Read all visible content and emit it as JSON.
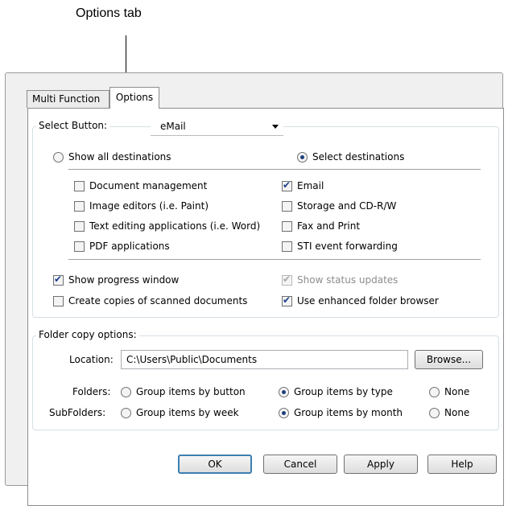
{
  "callout": {
    "label": "Options tab"
  },
  "tabs": [
    {
      "label": "Multi Function"
    },
    {
      "label": "Options"
    }
  ],
  "select_button": {
    "label": "Select Button:",
    "value": "eMail"
  },
  "destinations": {
    "show_all_label": "Show all destinations",
    "show_all_selected": false,
    "select_label": "Select destinations",
    "select_selected": true,
    "left_items": [
      {
        "label": "Document management",
        "checked": false
      },
      {
        "label": "Image editors (i.e. Paint)",
        "checked": false
      },
      {
        "label": "Text editing applications (i.e. Word)",
        "checked": false
      },
      {
        "label": "PDF applications",
        "checked": false
      }
    ],
    "right_items": [
      {
        "label": "Email",
        "checked": true
      },
      {
        "label": "Storage and CD-R/W",
        "checked": false
      },
      {
        "label": "Fax and Print",
        "checked": false
      },
      {
        "label": "STI event forwarding",
        "checked": false
      }
    ]
  },
  "options": {
    "show_progress": {
      "label": "Show progress window",
      "checked": true
    },
    "show_status": {
      "label": "Show status updates",
      "checked": true,
      "disabled": true
    },
    "create_copies": {
      "label": "Create copies of scanned documents",
      "checked": false
    },
    "enhanced_browser": {
      "label": "Use enhanced folder browser",
      "checked": true
    }
  },
  "folder_copy": {
    "title": "Folder copy options:",
    "location_label": "Location:",
    "location_value": "C:\\Users\\Public\\Documents",
    "browse_label": "Browse...",
    "folders_label": "Folders:",
    "folders_options": [
      "Group items by button",
      "Group items by type",
      "None"
    ],
    "folders_selected": "Group items by type",
    "subfolders_label": "SubFolders:",
    "subfolders_options": [
      "Group items by week",
      "Group items by month",
      "None"
    ],
    "subfolders_selected": "Group items by month"
  },
  "buttons": {
    "ok": "OK",
    "cancel": "Cancel",
    "apply": "Apply",
    "help": "Help"
  }
}
